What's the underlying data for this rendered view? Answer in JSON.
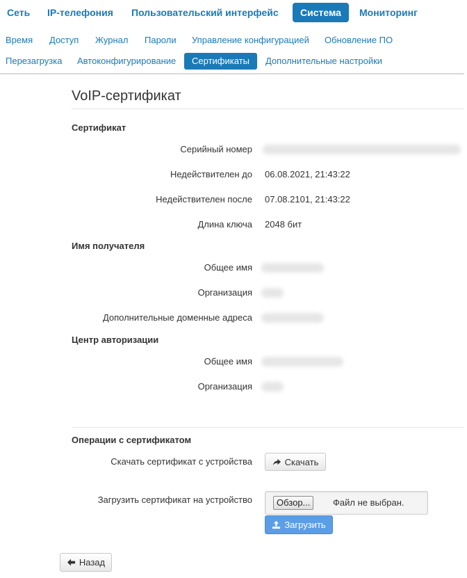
{
  "nav_main": [
    {
      "label": "Сеть"
    },
    {
      "label": "IP-телефония"
    },
    {
      "label": "Пользовательский интерфейс"
    },
    {
      "label": "Система",
      "active": true
    },
    {
      "label": "Мониторинг"
    }
  ],
  "nav_sub1": [
    {
      "label": "Время"
    },
    {
      "label": "Доступ"
    },
    {
      "label": "Журнал"
    },
    {
      "label": "Пароли"
    },
    {
      "label": "Управление конфигурацией"
    },
    {
      "label": "Обновление ПО"
    }
  ],
  "nav_sub2": [
    {
      "label": "Перезагрузка"
    },
    {
      "label": "Автоконфигурирование"
    },
    {
      "label": "Сертификаты",
      "active": true
    },
    {
      "label": "Дополнительные настройки"
    }
  ],
  "page": {
    "title": "VoIP-сертификат"
  },
  "certificate": {
    "heading": "Сертификат",
    "serial_label": "Серийный номер",
    "not_before_label": "Недействителен до",
    "not_before_value": "06.08.2021, 21:43:22",
    "not_after_label": "Недействителен после",
    "not_after_value": "07.08.2101, 21:43:22",
    "key_length_label": "Длина ключа",
    "key_length_value": "2048 бит"
  },
  "subject": {
    "heading": "Имя получателя",
    "common_name_label": "Общее имя",
    "organization_label": "Организация",
    "alt_names_label": "Дополнительные доменные адреса"
  },
  "issuer": {
    "heading": "Центр авторизации",
    "common_name_label": "Общее имя",
    "organization_label": "Организация"
  },
  "operations": {
    "heading": "Операции с сертификатом",
    "download_label": "Скачать сертификат с устройства",
    "download_button": "Скачать",
    "upload_label": "Загрузить сертификат на устройство",
    "browse_button": "Обзор...",
    "file_status": "Файл не выбран.",
    "upload_button": "Загрузить"
  },
  "back_button": "Назад",
  "colors": {
    "accent": "#1a7ab8",
    "primary_button": "#5b9ee6"
  },
  "icons": {
    "download": "share-arrow-icon",
    "upload": "upload-icon",
    "back": "arrow-left-icon"
  }
}
